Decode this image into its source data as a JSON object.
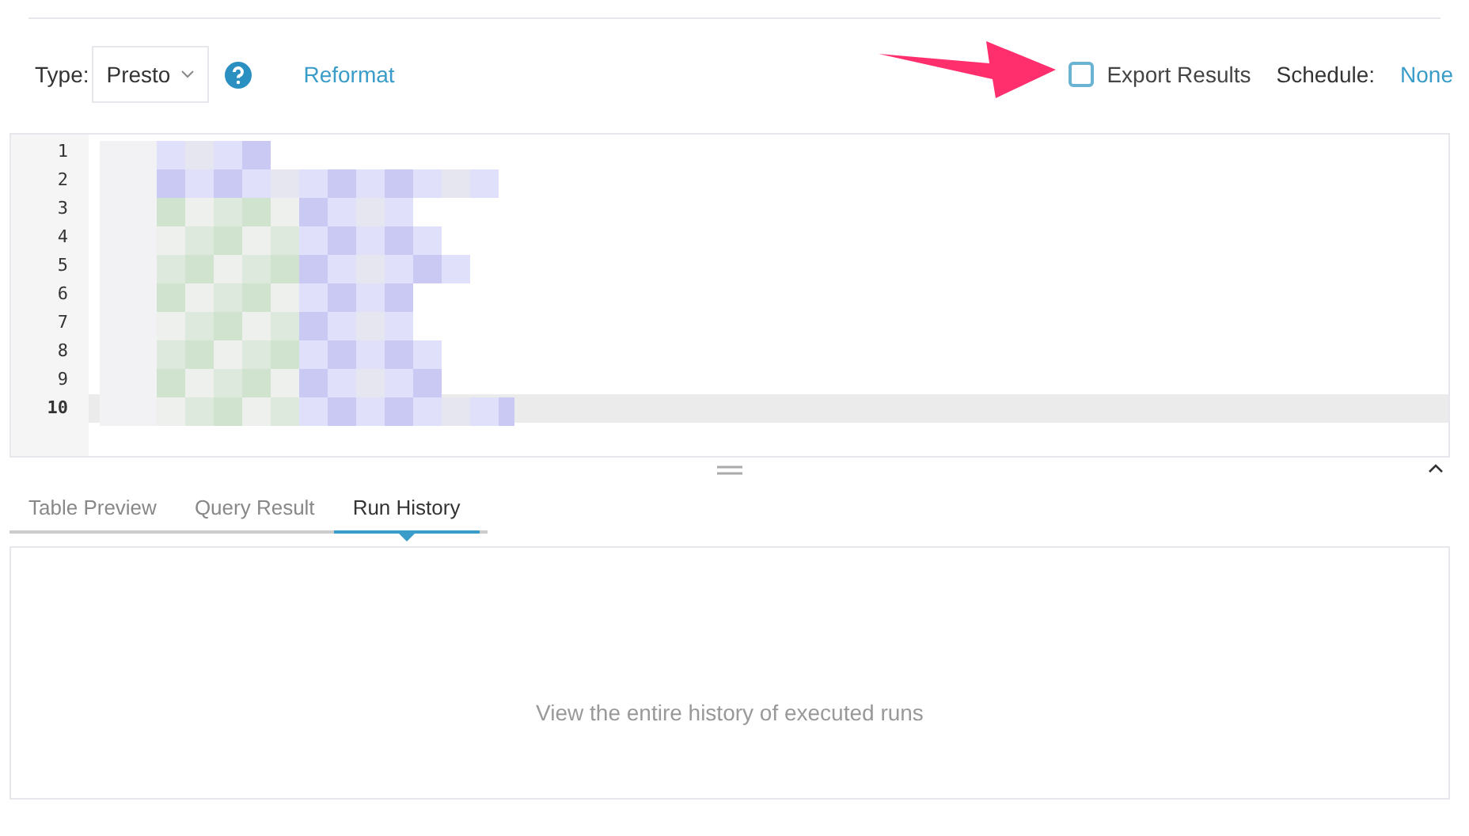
{
  "toolbar": {
    "type_label": "Type:",
    "type_value": "Presto",
    "reformat": "Reformat",
    "export_results": {
      "label": "Export Results",
      "checked": false
    },
    "schedule_label": "Schedule:",
    "schedule_value": "None"
  },
  "editor": {
    "lines": [
      {
        "number": "1",
        "selected": false
      },
      {
        "number": "2",
        "selected": false
      },
      {
        "number": "3",
        "selected": false
      },
      {
        "number": "4",
        "selected": false
      },
      {
        "number": "5",
        "selected": false
      },
      {
        "number": "6",
        "selected": false
      },
      {
        "number": "7",
        "selected": false
      },
      {
        "number": "8",
        "selected": false
      },
      {
        "number": "9",
        "selected": false
      },
      {
        "number": "10",
        "selected": true
      }
    ]
  },
  "tabs": [
    {
      "label": "Table Preview",
      "selected": false
    },
    {
      "label": "Query Result",
      "selected": false
    },
    {
      "label": "Run History",
      "selected": true
    }
  ],
  "panel": {
    "empty_message": "View the entire history of executed runs"
  }
}
